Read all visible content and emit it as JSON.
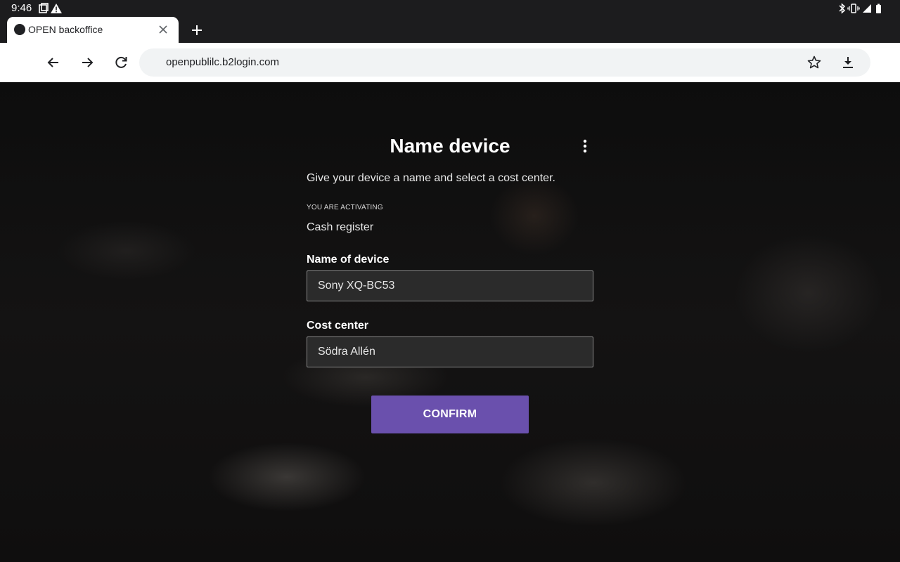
{
  "status_bar": {
    "time": "9:46",
    "left_icons": [
      "screenshot-icon",
      "warning-icon"
    ],
    "right_icons": [
      "bluetooth-icon",
      "vibrate-icon",
      "signal-icon",
      "battery-icon"
    ]
  },
  "browser": {
    "tab": {
      "title": "OPEN backoffice",
      "favicon": "open-logo-icon"
    },
    "url": "openpublilc.b2login.com"
  },
  "form": {
    "title": "Name device",
    "subtitle": "Give your device a name and select a cost center.",
    "activating_label": "YOU ARE ACTIVATING",
    "activating_value": "Cash register",
    "name_label": "Name of device",
    "name_value": "Sony XQ-BC53",
    "cost_label": "Cost center",
    "cost_value": "Södra Allén",
    "confirm_label": "CONFIRM"
  },
  "colors": {
    "accent": "#6a50ad",
    "page_background": "#121111",
    "field_background": "#2b2b2b",
    "browser_chrome": "#1c1c1e"
  }
}
